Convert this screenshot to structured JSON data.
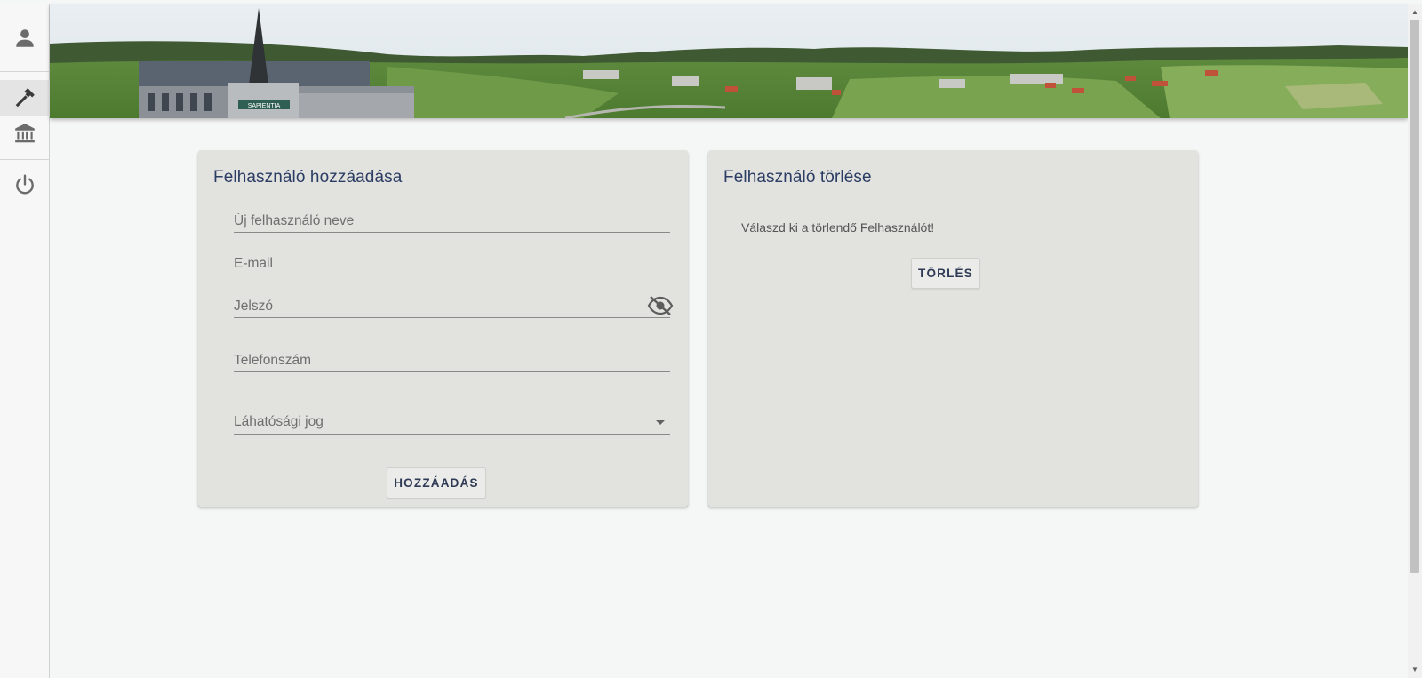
{
  "nav": {
    "items": [
      {
        "name": "profile",
        "icon": "person-icon"
      },
      {
        "name": "admin-tools",
        "icon": "hammer-icon",
        "active": true
      },
      {
        "name": "institution",
        "icon": "bank-icon"
      },
      {
        "name": "logout",
        "icon": "power-icon"
      }
    ]
  },
  "banner": {
    "image": "campus-panorama",
    "building_sign": "SAPIENTIA"
  },
  "add_user": {
    "title": "Felhasználó hozzáadása",
    "name_placeholder": "Új felhasználó neve",
    "email_placeholder": "E-mail",
    "password_placeholder": "Jelszó",
    "phone_placeholder": "Telefonszám",
    "role_label": "Láhatósági jog",
    "submit_label": "HOZZÁADÁS"
  },
  "delete_user": {
    "title": "Felhasználó törlése",
    "hint": "Válaszd ki a törlendő Felhasználót!",
    "submit_label": "TÖRLÉS"
  },
  "colors": {
    "title": "#2b3d63",
    "card_bg": "#e2e2df",
    "page_bg": "#f5f6f6"
  }
}
